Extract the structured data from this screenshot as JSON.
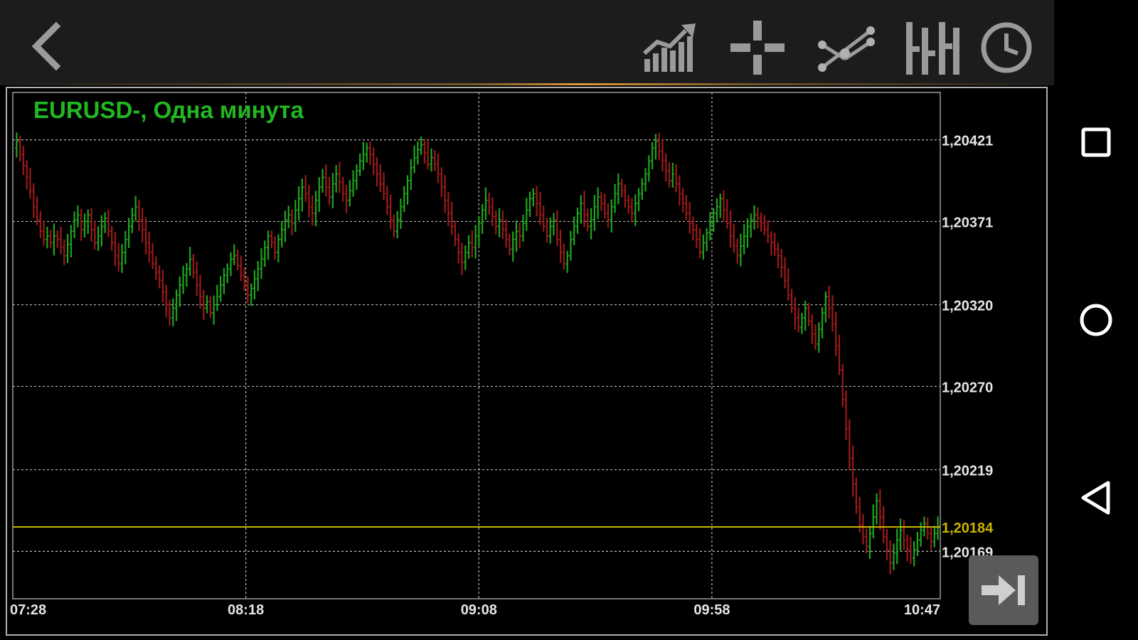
{
  "toolbar": {
    "icons": [
      "back-icon",
      "chart-type-icon",
      "crosshair-icon",
      "objects-icon",
      "bars-icon",
      "timeframe-clock-icon"
    ]
  },
  "navbar": {
    "icons": [
      "recent-apps-icon",
      "home-icon",
      "back-nav-icon"
    ]
  },
  "colors": {
    "background": "#000000",
    "toolbar": "#1c1c1c",
    "bull": "#1fa51f",
    "bear": "#9b1a1a",
    "title": "#22b822",
    "grid": "#b8b8b8",
    "axis_text": "#e6e6e6",
    "current_price": "#c9b400"
  },
  "chart_data": {
    "type": "bar",
    "title": "EURUSD-, Одна минута",
    "x_ticks": [
      "07:28",
      "08:18",
      "09:08",
      "09:58",
      "10:47"
    ],
    "y_ticks": [
      "1,20421",
      "1,20371",
      "1,20320",
      "1,20270",
      "1,20219",
      "1,20169"
    ],
    "current_price_label": "1,20184",
    "current_price": 1.20184,
    "ylim": [
      1.2014,
      1.2045
    ],
    "x_range": [
      "07:28",
      "10:47"
    ],
    "grid": true,
    "series": [
      {
        "start": "07:28",
        "interval": "1m",
        "close": [
          1.2042,
          1.20412,
          1.20405,
          1.20398,
          1.2039,
          1.2038,
          1.20372,
          1.20365,
          1.2036,
          1.20362,
          1.20358,
          1.20362,
          1.2036,
          1.20355,
          1.2035,
          1.20357,
          1.20365,
          1.20372,
          1.20375,
          1.20366,
          1.20371,
          1.20375,
          1.20366,
          1.20358,
          1.20362,
          1.20368,
          1.20373,
          1.20365,
          1.20358,
          1.2035,
          1.20345,
          1.20352,
          1.2036,
          1.20368,
          1.20375,
          1.2038,
          1.20372,
          1.20366,
          1.20358,
          1.20352,
          1.20345,
          1.2034,
          1.20335,
          1.20328,
          1.2032,
          1.20312,
          1.20318,
          1.20326,
          1.20332,
          1.20338,
          1.20342,
          1.20348,
          1.2034,
          1.20332,
          1.20325,
          1.20318,
          1.20322,
          1.20315,
          1.2032,
          1.20325,
          1.20332,
          1.20338,
          1.20342,
          1.20348,
          1.2035,
          1.20344,
          1.20338,
          1.20332,
          1.20326,
          1.2033,
          1.20336,
          1.20342,
          1.20348,
          1.20355,
          1.20362,
          1.20358,
          1.20352,
          1.2036,
          1.20366,
          1.20372,
          1.20375,
          1.2037,
          1.20378,
          1.20385,
          1.20392,
          1.20388,
          1.2038,
          1.20376,
          1.20384,
          1.20392,
          1.20398,
          1.20392,
          1.20386,
          1.20394,
          1.204,
          1.20395,
          1.20388,
          1.20384,
          1.2039,
          1.20396,
          1.20402,
          1.20408,
          1.20412,
          1.20416,
          1.20412,
          1.20406,
          1.204,
          1.20394,
          1.20388,
          1.2038,
          1.20372,
          1.20365,
          1.20372,
          1.2038,
          1.20388,
          1.20396,
          1.20404,
          1.2041,
          1.20415,
          1.20418,
          1.20413,
          1.20406,
          1.2041,
          1.20406,
          1.204,
          1.20392,
          1.20384,
          1.20376,
          1.20368,
          1.2036,
          1.20352,
          1.20346,
          1.20352,
          1.20358,
          1.20355,
          1.20362,
          1.2037,
          1.20378,
          1.20384,
          1.2038,
          1.20374,
          1.20368,
          1.20372,
          1.20366,
          1.2036,
          1.20354,
          1.2036,
          1.20365,
          1.20362,
          1.2037,
          1.20378,
          1.20385,
          1.20388,
          1.20382,
          1.20375,
          1.20368,
          1.20362,
          1.20368,
          1.20372,
          1.2036,
          1.20352,
          1.20345,
          1.2035,
          1.2036,
          1.20368,
          1.20376,
          1.20382,
          1.20375,
          1.20368,
          1.20372,
          1.2038,
          1.20386,
          1.20382,
          1.20376,
          1.20372,
          1.2038,
          1.20388,
          1.20394,
          1.2039,
          1.20384,
          1.2038,
          1.20376,
          1.20382,
          1.20388,
          1.20394,
          1.204,
          1.20408,
          1.20416,
          1.2042,
          1.20414,
          1.20408,
          1.20402,
          1.20396,
          1.204,
          1.20394,
          1.20388,
          1.20382,
          1.20376,
          1.2037,
          1.20366,
          1.2036,
          1.20352,
          1.20358,
          1.20364,
          1.2037,
          1.20376,
          1.2038,
          1.20385,
          1.20378,
          1.2037,
          1.20362,
          1.20356,
          1.2035,
          1.20356,
          1.20362,
          1.20368,
          1.20372,
          1.20375,
          1.20373,
          1.2037,
          1.20366,
          1.20362,
          1.20358,
          1.20354,
          1.2035,
          1.20343,
          1.20335,
          1.20326,
          1.20318,
          1.20312,
          1.20306,
          1.20312,
          1.20318,
          1.2031,
          1.20302,
          1.20296,
          1.20305,
          1.20315,
          1.20325,
          1.20318,
          1.20308,
          1.20295,
          1.2028,
          1.20262,
          1.20244,
          1.20226,
          1.2021,
          1.20196,
          1.20185,
          1.20178,
          1.20172,
          1.2018,
          1.2019,
          1.202,
          1.2019,
          1.20178,
          1.2017,
          1.20162,
          1.20168,
          1.20176,
          1.20182,
          1.20176,
          1.2017,
          1.20165,
          1.2017,
          1.20176,
          1.20182,
          1.20186,
          1.2018,
          1.20175,
          1.2018,
          1.20184
        ]
      }
    ]
  }
}
